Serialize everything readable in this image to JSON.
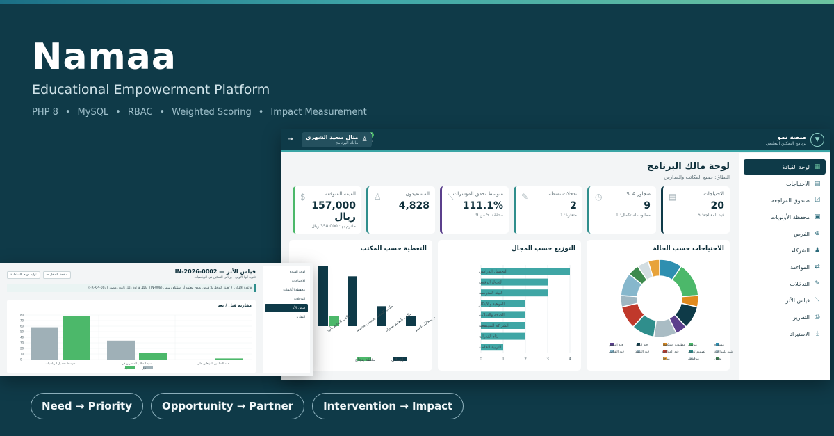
{
  "hero": {
    "title": "Namaa",
    "subtitle": "Educational Empowerment Platform",
    "tech": [
      "PHP 8",
      "MySQL",
      "RBAC",
      "Weighted Scoring",
      "Impact Measurement"
    ]
  },
  "pills": [
    "Need → Priority",
    "Opportunity → Partner",
    "Intervention → Impact"
  ],
  "app": {
    "brand": {
      "name": "منصة نمو",
      "tagline": "برنامج التمكين التعليمي"
    },
    "user": {
      "name": "منال سعيد الشهري",
      "role": "مالك البرنامج"
    },
    "notifications": "2",
    "sidebar": [
      {
        "label": "لوحة القيادة",
        "icon": "grid-icon",
        "glyph": "▦",
        "active": true
      },
      {
        "label": "الاحتياجات",
        "icon": "document-icon",
        "glyph": "▤",
        "active": false
      },
      {
        "label": "صندوق المراجعة",
        "icon": "check-box-icon",
        "glyph": "☑",
        "active": false
      },
      {
        "label": "محفظة الأولويات",
        "icon": "briefcase-icon",
        "glyph": "▣",
        "active": false
      },
      {
        "label": "الفرص",
        "icon": "plus-circle-icon",
        "glyph": "⊕",
        "active": false
      },
      {
        "label": "الشركاء",
        "icon": "users-icon",
        "glyph": "♟",
        "active": false
      },
      {
        "label": "المواءمة",
        "icon": "swap-icon",
        "glyph": "⇄",
        "active": false
      },
      {
        "label": "التدخلات",
        "icon": "pencil-icon",
        "glyph": "✎",
        "active": false
      },
      {
        "label": "قياس الأثر",
        "icon": "line-chart-icon",
        "glyph": "⟋",
        "active": false
      },
      {
        "label": "التقارير",
        "icon": "printer-icon",
        "glyph": "⎙",
        "active": false
      },
      {
        "label": "الاستيراد",
        "icon": "download-icon",
        "glyph": "⤓",
        "active": false
      }
    ],
    "page_title": "لوحة مالك البرنامج",
    "scope": "النطاق: جميع المكاتب والمدارس",
    "kpis": [
      {
        "label": "الاحتياجات",
        "value": "20",
        "note": "قيد المعالجة: 6",
        "accent": "#0e3a48",
        "icon": "document-icon",
        "glyph": "▤"
      },
      {
        "label": "متجاوز SLA",
        "value": "9",
        "note": "مطلوب استكمال: 1",
        "accent": "#2f8e8c",
        "icon": "clock-icon",
        "glyph": "◷"
      },
      {
        "label": "تدخلات نشطة",
        "value": "2",
        "note": "متعثرة: 1",
        "accent": "#2f8e8c",
        "icon": "pencil-icon",
        "glyph": "✎"
      },
      {
        "label": "متوسط تحقق المؤشرات",
        "value": "111.1%",
        "note": "محققة: 5 من 9",
        "accent": "#5b3f8c",
        "icon": "line-chart-icon",
        "glyph": "⟋"
      },
      {
        "label": "المستفيدون",
        "value": "4,828",
        "note": "",
        "accent": "#2f8e8c",
        "icon": "user-icon",
        "glyph": "♙"
      },
      {
        "label": "القيمة المتوقعة",
        "value": "157,000 ريال",
        "note": "ملتزم بها: 358,000 ريال",
        "accent": "#4cb86a",
        "icon": "coin-icon",
        "glyph": "$"
      }
    ],
    "charts": {
      "status_title": "الاحتياجات حسب الحالة",
      "field_title": "التوزيع حسب المجال",
      "office_title": "التغطية حسب المكتب"
    }
  },
  "chart_data": [
    {
      "type": "pie",
      "title": "الاحتياجات حسب الحالة",
      "categories": [
        "مسودة",
        "مرسل",
        "مطلوب استكمال",
        "قيد الفرز",
        "قيد التقييم",
        "معتمد للمواءمة",
        "تصميم تدخل",
        "قيد المواءمة",
        "قيد التنفيذ",
        "قيد القياس",
        "مغلق",
        "مرفوض",
        "مؤجل"
      ],
      "values": [
        2,
        3,
        1,
        2,
        1,
        2,
        2,
        2,
        1,
        2,
        1,
        1,
        1
      ],
      "colors": [
        "#2f8fb0",
        "#4cb86a",
        "#e08a1e",
        "#0e3a48",
        "#5b3f8c",
        "#a9bcc4",
        "#2f8e8c",
        "#c0392b",
        "#9fb7c2",
        "#86b7cc",
        "#3d8a4d",
        "#d2dde1",
        "#e8a33a"
      ],
      "legend": "bottom"
    },
    {
      "type": "bar",
      "title": "التوزيع حسب المجال",
      "orientation": "horizontal",
      "categories": [
        "التحصيل الدراسي",
        "التحول الرقمي",
        "البيئة المدرسية",
        "الموهبة والابتكار",
        "الصحة والسلامة",
        "الشراكة المجتمعية",
        "بناء القدرات",
        "التربية الخاصة"
      ],
      "values": [
        4,
        3,
        3,
        2,
        2,
        2,
        2,
        1
      ],
      "xticks": [
        0,
        1,
        2,
        3,
        4
      ],
      "color": "#3fa6a5",
      "grid": true
    },
    {
      "type": "bar",
      "title": "التغطية حسب المكتب",
      "categories": [
        "مكتب التعليم بمحايل عسير",
        "مكتب التعليم بسراة",
        "مكتب التعليم بخميس مشيط",
        "مكتب التعليم بأبها"
      ],
      "series": [
        {
          "name": "إجمالي",
          "values": [
            1,
            2,
            5,
            6
          ],
          "color": "#0e3a48"
        },
        {
          "name": "مغلقة بنجاح",
          "values": [
            0,
            0,
            0,
            1
          ],
          "color": "#4cb86a"
        }
      ],
      "legend": "bottom"
    },
    {
      "type": "bar",
      "title": "مقارنة قبل / بعد",
      "categories": [
        "متوسط تحصيل الرياضيات",
        "نسبة الطلاب المتعثرين في",
        "عدد المعلمين المؤهلين على"
      ],
      "series": [
        {
          "name": "قبل",
          "values": [
            58,
            34,
            0
          ],
          "color": "#9fb0b7"
        },
        {
          "name": "بعد",
          "values": [
            78,
            12,
            2
          ],
          "color": "#4cb86a"
        }
      ],
      "yticks": [
        0,
        10,
        20,
        30,
        40,
        50,
        60,
        70,
        80
      ],
      "legend": "bottom"
    }
  ],
  "app2": {
    "title": "قياس الأثر — IN-2026-0002",
    "subtitle": "ثانوية أبها الأولى - برنامج التمكين في الرياضيات",
    "back_button": "← صفحة التدخل",
    "generate_button": "توليد مهام الاستدامة",
    "note": "قاعدة الإغلاق: لا يُغلق التدخل بلا قياس بعدي معتمد أو استثناء رسمي (IN-008)، ولكل قراءة دليل تاريخ ومصدر (FR-KPI-003).",
    "chart_title": "مقارنة قبل / بعد",
    "sidebar": [
      "لوحة القيادة",
      "الاحتياجات",
      "محفظة الأولويات",
      "التدخلات",
      "قياس الأثر",
      "التقارير"
    ],
    "active_index": 4
  }
}
